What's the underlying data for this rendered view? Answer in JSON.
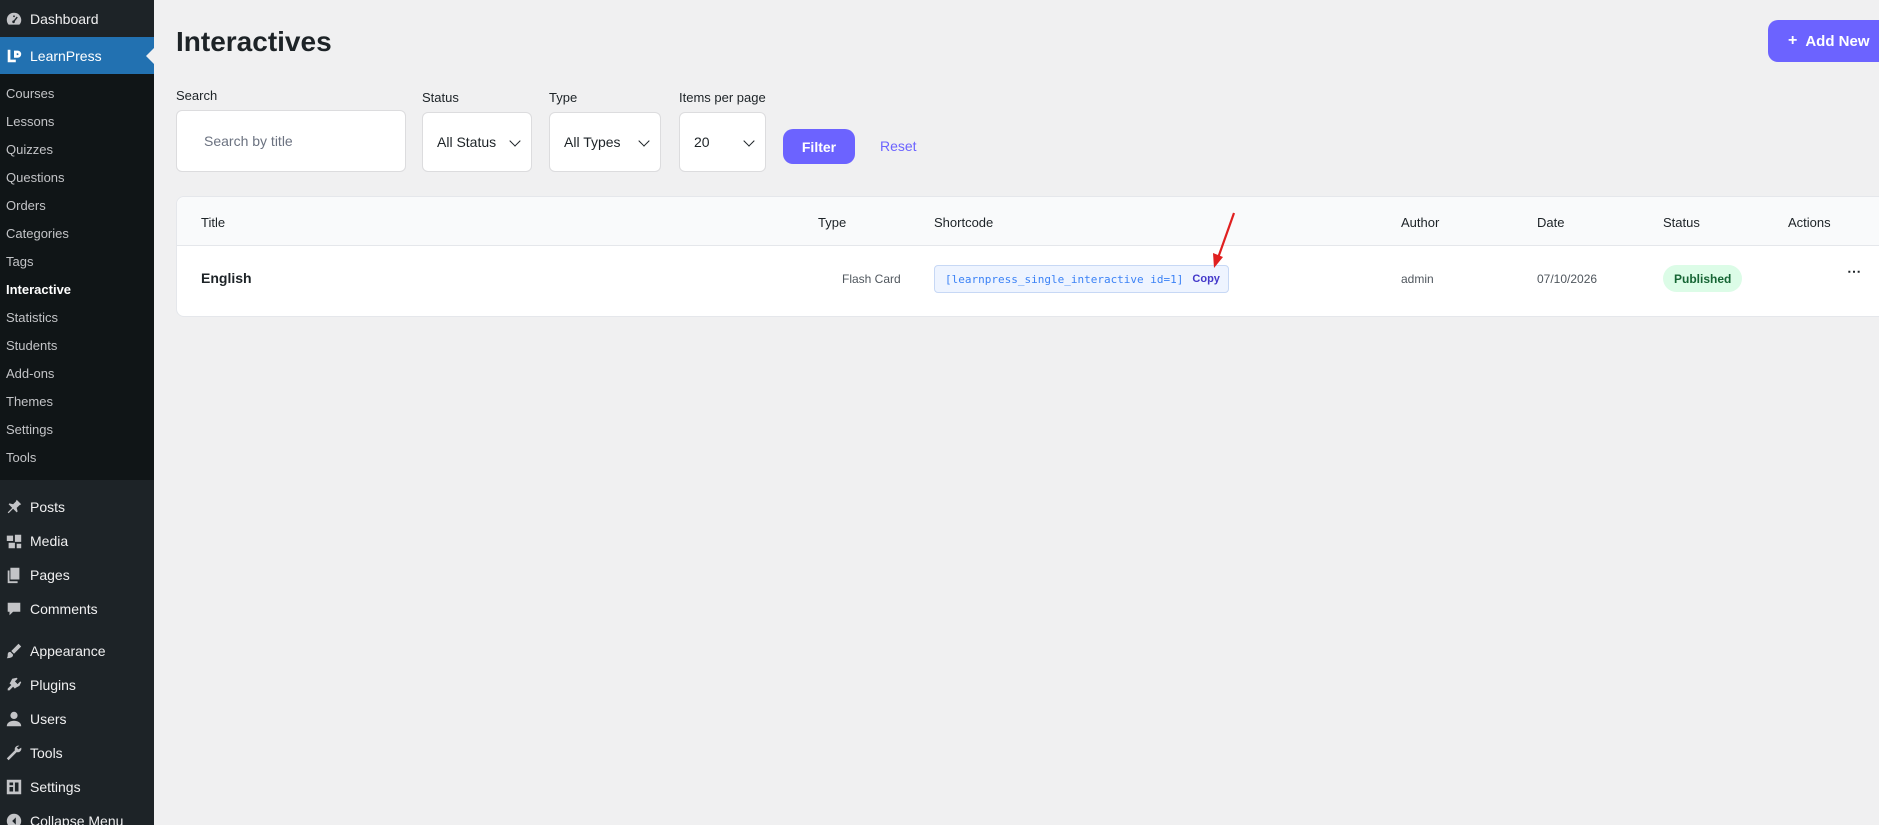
{
  "sidebar": {
    "dashboard": "Dashboard",
    "learnpress": "LearnPress",
    "submenu": [
      "Courses",
      "Lessons",
      "Quizzes",
      "Questions",
      "Orders",
      "Categories",
      "Tags",
      "Interactive",
      "Statistics",
      "Students",
      "Add-ons",
      "Themes",
      "Settings",
      "Tools"
    ],
    "active_submenu": "Interactive",
    "menu": [
      {
        "label": "Posts",
        "icon": "pin-icon"
      },
      {
        "label": "Media",
        "icon": "media-icon"
      },
      {
        "label": "Pages",
        "icon": "pages-icon"
      },
      {
        "label": "Comments",
        "icon": "comment-icon"
      },
      {
        "label": "Appearance",
        "icon": "brush-icon"
      },
      {
        "label": "Plugins",
        "icon": "plugin-icon"
      },
      {
        "label": "Users",
        "icon": "user-icon"
      },
      {
        "label": "Tools",
        "icon": "wrench-icon"
      },
      {
        "label": "Settings",
        "icon": "settings-icon"
      },
      {
        "label": "Collapse Menu",
        "icon": "collapse-icon"
      }
    ]
  },
  "page": {
    "title": "Interactives",
    "add_new": "Add New"
  },
  "filters": {
    "search_label": "Search",
    "search_placeholder": "Search by title",
    "status_label": "Status",
    "status_value": "All Status",
    "type_label": "Type",
    "type_value": "All Types",
    "per_page_label": "Items per page",
    "per_page_value": "20",
    "filter_button": "Filter",
    "reset_link": "Reset"
  },
  "table": {
    "columns": [
      "Title",
      "Type",
      "Shortcode",
      "Author",
      "Date",
      "Status",
      "Actions"
    ],
    "rows": [
      {
        "title": "English",
        "type": "Flash Card",
        "shortcode": "[learnpress_single_interactive id=1]",
        "copy": "Copy",
        "author": "admin",
        "date": "07/10/2026",
        "status": "Published",
        "actions": "⋯"
      }
    ]
  },
  "colors": {
    "sidebar_bg": "#1d2327",
    "current_menu": "#2271b1",
    "accent": "#6c63ff",
    "badge_bg": "#dcfce7",
    "annotation_arrow": "#e02020"
  }
}
